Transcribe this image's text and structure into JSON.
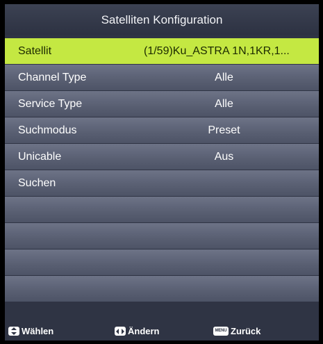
{
  "title": "Satelliten Konfiguration",
  "rows": [
    {
      "label": "Satellit",
      "value": "(1/59)Ku_ASTRA 1N,1KR,1..."
    },
    {
      "label": "Channel Type",
      "value": "Alle"
    },
    {
      "label": "Service Type",
      "value": "Alle"
    },
    {
      "label": "Suchmodus",
      "value": "Preset"
    },
    {
      "label": "Unicable",
      "value": "Aus"
    },
    {
      "label": "Suchen",
      "value": ""
    }
  ],
  "footer": {
    "select_label": "Wählen",
    "change_label": "Ändern",
    "back_label": "Zurück",
    "menu_key_text": "MENU"
  },
  "colors": {
    "selected_row": "#c4e842",
    "panel": "#2f3444"
  }
}
